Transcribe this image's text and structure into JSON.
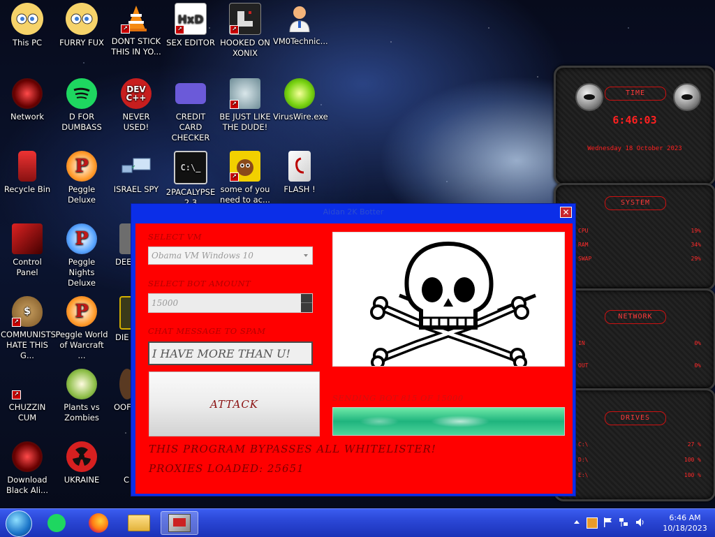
{
  "desktop": {
    "icons": [
      {
        "label": "This PC"
      },
      {
        "label": "FURRY FUX"
      },
      {
        "label": "DONT STICK THIS IN YO..."
      },
      {
        "label": "SEX EDITOR"
      },
      {
        "label": "HOOKED ON XONIX"
      },
      {
        "label": "VM0Technic..."
      },
      {
        "label": "Network"
      },
      {
        "label": "D FOR DUMBASS"
      },
      {
        "label": "NEVER USED!"
      },
      {
        "label": "CREDIT CARD CHECKER"
      },
      {
        "label": "BE JUST LIKE THE DUDE!"
      },
      {
        "label": "VirusWire.exe"
      },
      {
        "label": "Recycle Bin"
      },
      {
        "label": "Peggle Deluxe"
      },
      {
        "label": "ISRAEL SPY"
      },
      {
        "label": "2PACALYPSE 2.3"
      },
      {
        "label": "some of you need to ac..."
      },
      {
        "label": "FLASH !"
      },
      {
        "label": "Control Panel"
      },
      {
        "label": "Peggle Nights Deluxe"
      },
      {
        "label": "DEE"
      },
      {
        "label": "COMMUNISTS HATE THIS G..."
      },
      {
        "label": "Peggle World of Warcraft ..."
      },
      {
        "label": "DIE"
      },
      {
        "label": "CHUZZIN CUM"
      },
      {
        "label": "Plants vs Zombies"
      },
      {
        "label": "OOF DC"
      },
      {
        "label": "Download Black Ali..."
      },
      {
        "label": "UKRAINE"
      },
      {
        "label": "C"
      }
    ],
    "icon_text": {
      "dev": "DEV",
      "dev_sub": "C++",
      "hxd": "HxD",
      "cmd": "C:\\_"
    }
  },
  "gadgets": {
    "time": {
      "title": "TIME",
      "clock": "6:46:03",
      "date": "Wednesday 18 October 2023"
    },
    "system": {
      "title": "SYSTEM",
      "rows": [
        {
          "label": "CPU",
          "value": "19%"
        },
        {
          "label": "RAM",
          "value": "34%"
        },
        {
          "label": "SWAP",
          "value": "29%"
        }
      ]
    },
    "network": {
      "title": "NETWORK",
      "rows": [
        {
          "label": "IN",
          "value": "0%"
        },
        {
          "label": "OUT",
          "value": "0%"
        }
      ]
    },
    "drives": {
      "title": "DRIVES",
      "rows": [
        {
          "label": "C:\\",
          "value": "27 %"
        },
        {
          "label": "D:\\",
          "value": "100 %"
        },
        {
          "label": "E:\\",
          "value": "100 %"
        }
      ]
    }
  },
  "app": {
    "title": "Aidan 2K Botter",
    "select_vm_label": "SELECT VM",
    "select_vm_value": "Obama VM Windows 10",
    "bot_amount_label": "SELECT BOT AMOUNT",
    "bot_amount_value": "15000",
    "chat_label": "CHAT MESSAGE TO SPAM",
    "chat_value": "I HAVE MORE THAN U!",
    "attack_label": "ATTACK",
    "status_text": "SENDING BOT 815 OF 15000",
    "progress_fraction": 1.0,
    "note1": "THIS PROGRAM BYPASSES ALL WHITELISTER!",
    "note2": "PROXIES LOADED: 25651"
  },
  "taskbar": {
    "time": "6:46 AM",
    "date": "10/18/2023"
  },
  "colors": {
    "window_frame": "#0b2ee8",
    "client_bg": "#ff0000",
    "gadget_red": "#ff2a2a",
    "taskbar": "#2b47d6"
  }
}
